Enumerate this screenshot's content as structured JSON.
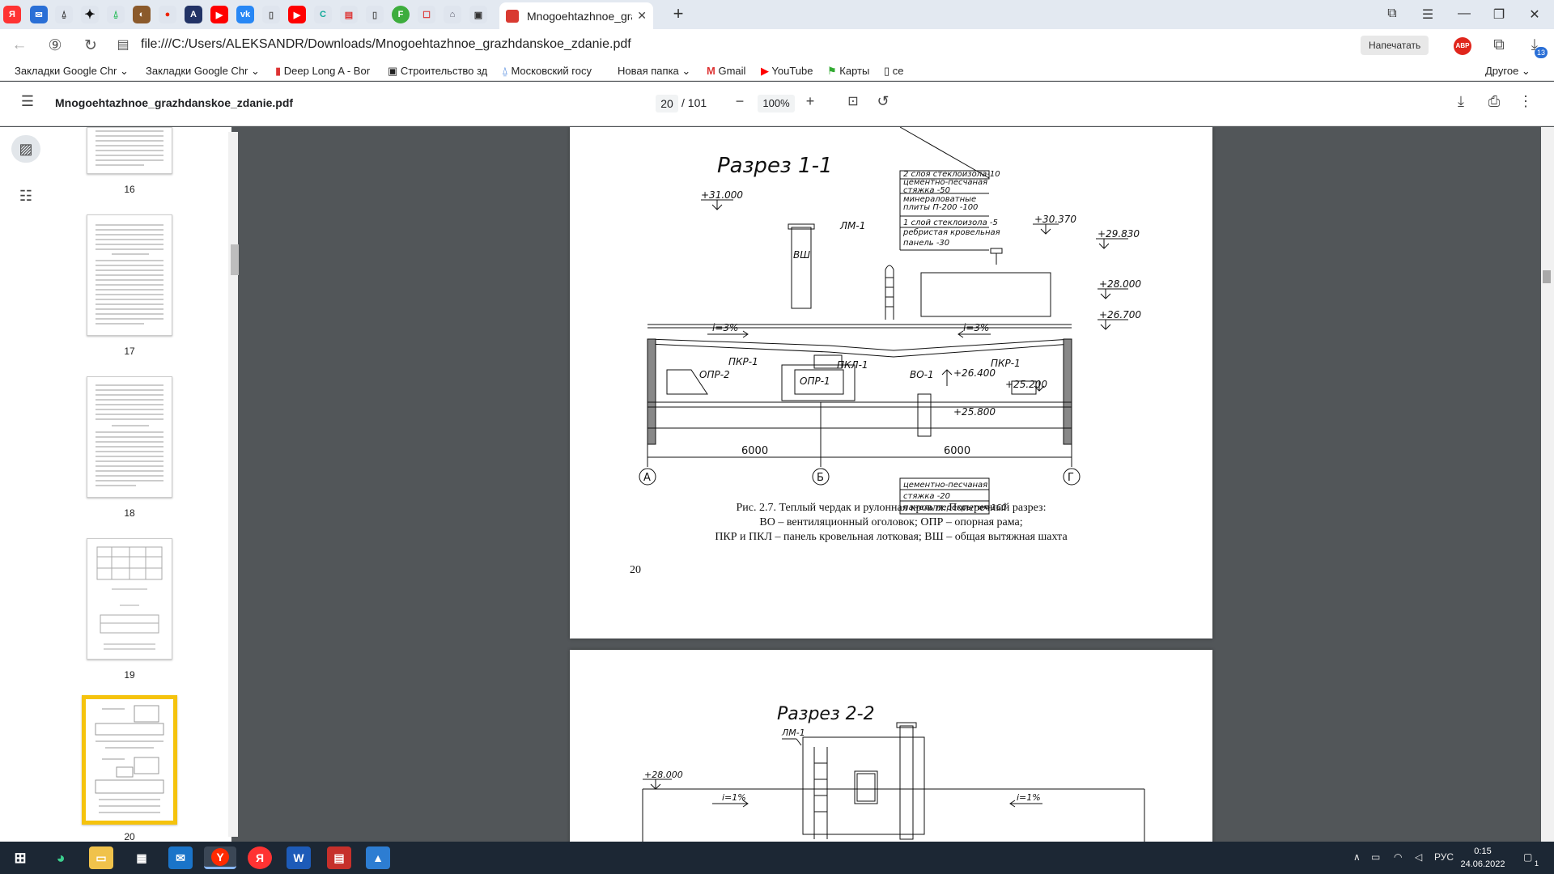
{
  "browser": {
    "tab_title": "Mnogoehtazhnoe_grazh",
    "address": "file:///C:/Users/ALEKSANDR/Downloads/Mnogoehtazhnoe_grazhdanskoe_zdanie.pdf",
    "print_label": "Напечатать",
    "abp_label": "ABP",
    "downloads_badge": "13"
  },
  "bookmarks": [
    "Закладки Google Chr",
    "Закладки Google Chr",
    "Deep Long A - Bor",
    "Строительство зд",
    "Московский госу",
    "Новая папка",
    "Gmail",
    "YouTube",
    "Карты",
    "ce"
  ],
  "bookmarks_other": "Другое",
  "pdf": {
    "filename": "Mnogoehtazhnoe_grazhdanskoe_zdanie.pdf",
    "current_page": "20",
    "total_pages": "/ 101",
    "zoom": "100%"
  },
  "thumbnails": [
    "16",
    "17",
    "18",
    "19",
    "20"
  ],
  "page20": {
    "drawing_title": "Разрез 1-1",
    "layers_top": [
      "2 слоя стеклоизола-10",
      "цементно-песчаная",
      "стяжка              -50",
      "минераловатные",
      "плиты П-200      -100",
      "1 слой стеклоизола -5",
      "ребристая кровельная",
      "панель              -30"
    ],
    "layers_bottom": [
      "цементно-песчаная",
      "стяжка              -20",
      "панель перекрытия-160"
    ],
    "elev_31000": "+31.000",
    "elev_30370": "+30.370",
    "elev_29830": "+29.830",
    "elev_28000": "+28.000",
    "elev_26700": "+26.700",
    "elev_26400": "+26.400",
    "elev_25200": "+25.200",
    "elev_25800": "+25.800",
    "lbl_lm1": "ЛМ-1",
    "lbl_vsh": "ВШ",
    "lbl_slope": "i=3%",
    "lbl_pkr1": "ПКР-1",
    "lbl_pkl1": "ПКЛ-1",
    "lbl_opr2": "ОПР-2",
    "lbl_opr1": "ОПР-1",
    "lbl_vo1": "ВО-1",
    "dim_6000": "6000",
    "axis_a": "А",
    "axis_b": "Б",
    "axis_g": "Г",
    "caption_1": "Рис. 2.7. Теплый чердак и рулонная кровля. Поперечный разрез:",
    "caption_2": "ВО – вентиляционный оголовок; ОПР – опорная рама;",
    "caption_3": "ПКР и ПКЛ – панель кровельная лотковая; ВШ – общая вытяжная шахта",
    "page_number": "20"
  },
  "page21": {
    "drawing_title": "Разрез 2-2",
    "lbl_lm1": "ЛМ-1",
    "elev_28000": "+28.000",
    "lbl_slope": "i=1%"
  },
  "taskbar": {
    "lang": "РУС",
    "time": "0:15",
    "date": "24.06.2022",
    "notif": "1"
  }
}
